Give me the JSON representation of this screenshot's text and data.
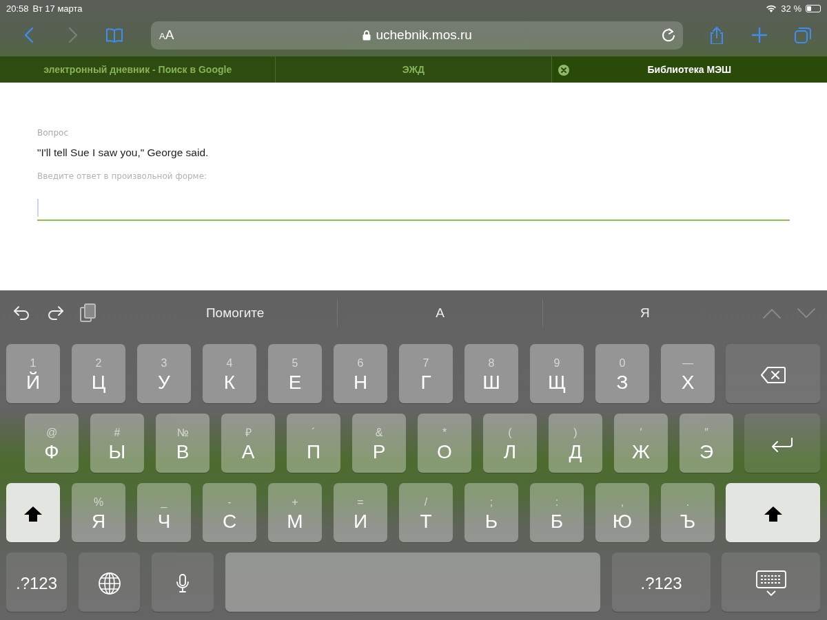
{
  "status_bar": {
    "time": "20:58",
    "date": "Вт 17 марта",
    "battery": "32 %"
  },
  "toolbar": {
    "back_enabled": true,
    "forward_enabled": false,
    "text_size": {
      "small": "A",
      "large": "A"
    },
    "url": "uchebnik.mos.ru"
  },
  "tabs": [
    {
      "label": "электронный дневник - Поиск в Google",
      "selected": false
    },
    {
      "label": "ЭЖД",
      "selected": false
    },
    {
      "label": "Библиотека МЭШ",
      "selected": true
    }
  ],
  "page": {
    "label": "Вопрос",
    "question": "\"I'll tell Sue I saw you,\" George said.",
    "prompt": "Введите ответ в произвольной форме:",
    "answer": {
      "focused": true
    }
  },
  "keyboard": {
    "suggestions": [
      "Помогите",
      "А",
      "Я"
    ],
    "shift_on": true,
    "rows": [
      {
        "keys": [
          {
            "kind": "letter",
            "main": "Й",
            "alt": "1"
          },
          {
            "kind": "letter",
            "main": "Ц",
            "alt": "2"
          },
          {
            "kind": "letter",
            "main": "У",
            "alt": "3"
          },
          {
            "kind": "letter",
            "main": "К",
            "alt": "4"
          },
          {
            "kind": "letter",
            "main": "Е",
            "alt": "5"
          },
          {
            "kind": "letter",
            "main": "Н",
            "alt": "6"
          },
          {
            "kind": "letter",
            "main": "Г",
            "alt": "7"
          },
          {
            "kind": "letter",
            "main": "Ш",
            "alt": "8"
          },
          {
            "kind": "letter",
            "main": "Щ",
            "alt": "9"
          },
          {
            "kind": "letter",
            "main": "З",
            "alt": "0"
          },
          {
            "kind": "letter",
            "main": "Х",
            "alt": "—"
          },
          {
            "kind": "backspace"
          }
        ]
      },
      {
        "keys": [
          {
            "kind": "letter",
            "main": "Ф",
            "alt": "@"
          },
          {
            "kind": "letter",
            "main": "Ы",
            "alt": "#"
          },
          {
            "kind": "letter",
            "main": "В",
            "alt": "№"
          },
          {
            "kind": "letter",
            "main": "А",
            "alt": "₽"
          },
          {
            "kind": "letter",
            "main": "П",
            "alt": "´"
          },
          {
            "kind": "letter",
            "main": "Р",
            "alt": "&"
          },
          {
            "kind": "letter",
            "main": "О",
            "alt": "*"
          },
          {
            "kind": "letter",
            "main": "Л",
            "alt": "("
          },
          {
            "kind": "letter",
            "main": "Д",
            "alt": ")"
          },
          {
            "kind": "letter",
            "main": "Ж",
            "alt": "′"
          },
          {
            "kind": "letter",
            "main": "Э",
            "alt": "″"
          },
          {
            "kind": "return"
          }
        ]
      },
      {
        "keys": [
          {
            "kind": "shift"
          },
          {
            "kind": "letter",
            "main": "Я",
            "alt": "%"
          },
          {
            "kind": "letter",
            "main": "Ч",
            "alt": "_"
          },
          {
            "kind": "letter",
            "main": "С",
            "alt": "-"
          },
          {
            "kind": "letter",
            "main": "М",
            "alt": "+"
          },
          {
            "kind": "letter",
            "main": "И",
            "alt": "="
          },
          {
            "kind": "letter",
            "main": "Т",
            "alt": "/"
          },
          {
            "kind": "letter",
            "main": "Ь",
            "alt": ";"
          },
          {
            "kind": "letter",
            "main": "Б",
            "alt": ":"
          },
          {
            "kind": "letter",
            "main": "Ю",
            "alt": ","
          },
          {
            "kind": "letter",
            "main": "Ъ",
            "alt": "."
          },
          {
            "kind": "shift"
          }
        ]
      },
      {
        "keys": [
          {
            "kind": "symbols",
            "main": ".?123"
          },
          {
            "kind": "globe"
          },
          {
            "kind": "mic"
          },
          {
            "kind": "space"
          },
          {
            "kind": "symbols",
            "main": ".?123"
          },
          {
            "kind": "hide"
          }
        ]
      }
    ]
  }
}
